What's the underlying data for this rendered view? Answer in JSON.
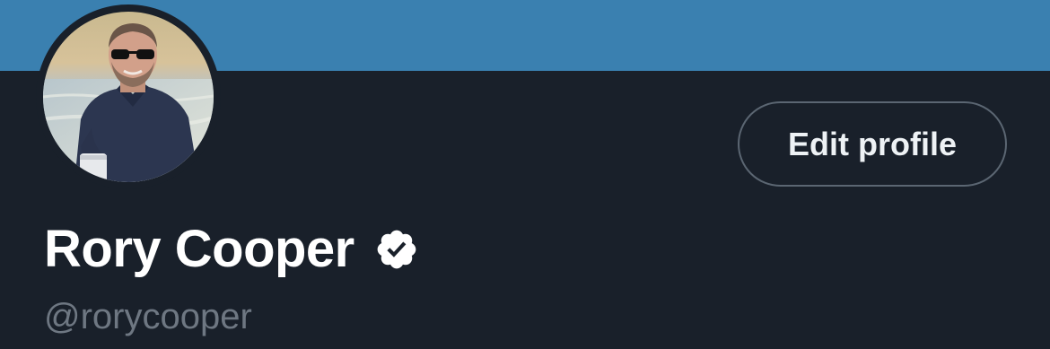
{
  "colors": {
    "banner": "#3a80b0",
    "background": "#19202a",
    "name_text": "#ffffff",
    "handle_text": "#6e7782",
    "button_border": "#5b6672",
    "button_text": "#eef2f5"
  },
  "profile": {
    "display_name": "Rory Cooper",
    "verified": true,
    "verified_icon": "verified-badge-icon",
    "handle": "@rorycooper",
    "avatar": "profile-photo"
  },
  "actions": {
    "edit_profile_label": "Edit profile"
  }
}
